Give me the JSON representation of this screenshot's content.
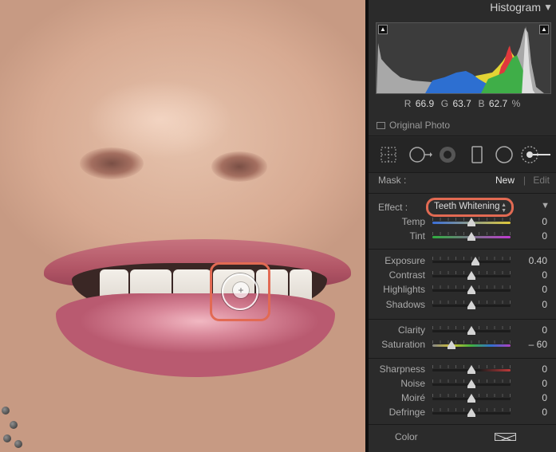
{
  "histogram": {
    "title": "Histogram",
    "collapse_icon": "triangle-down-icon",
    "shadow_clip_icon": "clipping-triangle-icon",
    "highlight_clip_icon": "clipping-triangle-icon",
    "r_label": "R",
    "r_value": "66.9",
    "g_label": "G",
    "g_value": "63.7",
    "b_label": "B",
    "b_value": "62.7",
    "percent": "%",
    "original_photo": "Original Photo"
  },
  "tools": [
    "crop-overlay-icon",
    "spot-removal-icon",
    "red-eye-icon",
    "graduated-filter-icon",
    "radial-filter-icon",
    "adjustment-brush-icon"
  ],
  "mask": {
    "label": "Mask :",
    "new": "New",
    "divider": "|",
    "edit": "Edit"
  },
  "effect": {
    "label": "Effect :",
    "value": "Teeth Whitening"
  },
  "sliders": [
    {
      "label": "Temp",
      "value": "0",
      "level": 0.5,
      "track": "temp"
    },
    {
      "label": "Tint",
      "value": "0",
      "level": 0.5,
      "track": "tint"
    },
    {
      "label": "Exposure",
      "value": "0.40",
      "level": 0.55,
      "track": "plain"
    },
    {
      "label": "Contrast",
      "value": "0",
      "level": 0.5,
      "track": "plain"
    },
    {
      "label": "Highlights",
      "value": "0",
      "level": 0.5,
      "track": "plain"
    },
    {
      "label": "Shadows",
      "value": "0",
      "level": 0.5,
      "track": "plain"
    },
    {
      "label": "Clarity",
      "value": "0",
      "level": 0.5,
      "track": "plain"
    },
    {
      "label": "Saturation",
      "value": "– 60",
      "level": 0.24,
      "track": "saturation"
    },
    {
      "label": "Sharpness",
      "value": "0",
      "level": 0.5,
      "track": "sharp"
    },
    {
      "label": "Noise",
      "value": "0",
      "level": 0.5,
      "track": "plain"
    },
    {
      "label": "Moiré",
      "value": "0",
      "level": 0.5,
      "track": "plain"
    },
    {
      "label": "Defringe",
      "value": "0",
      "level": 0.5,
      "track": "plain"
    }
  ],
  "color": {
    "label": "Color",
    "swatch_icon": "no-color-swatch-icon"
  },
  "canvas": {
    "pin_icon": "crosshair-icon"
  },
  "colors": {
    "highlight": "#e26a53",
    "panel_bg": "#2b2b2b",
    "accent_text": "#e6e6e6"
  }
}
